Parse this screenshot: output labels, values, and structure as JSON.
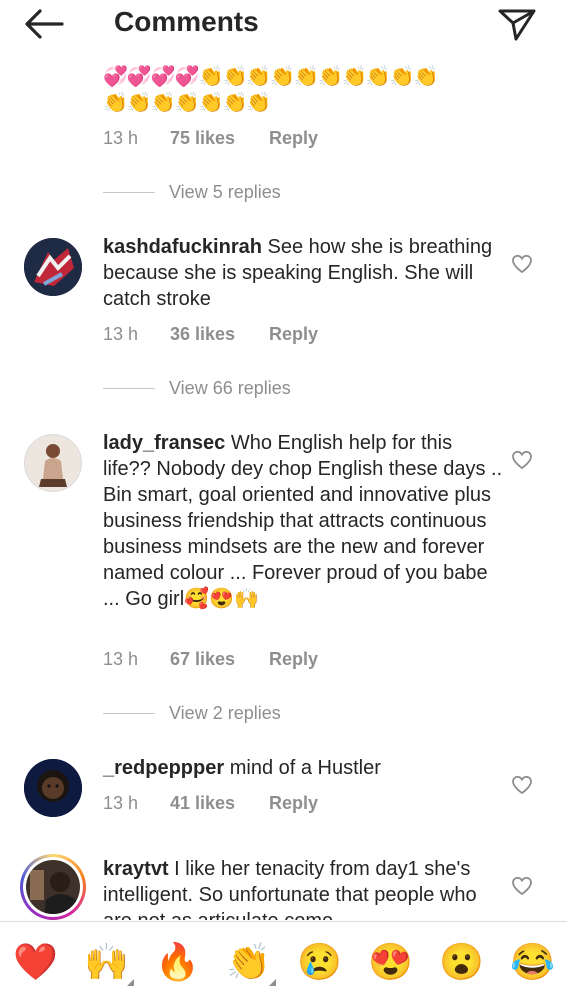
{
  "header": {
    "title": "Comments",
    "back_icon": "arrow-left-icon",
    "send_icon": "paper-plane-icon"
  },
  "top_comment": {
    "emoji_row_1": "💞💞💞💞👏👏👏👏👏👏👏👏👏👏",
    "emoji_row_2": "👏👏👏👏👏👏👏",
    "time": "13 h",
    "likes": "75 likes",
    "reply": "Reply",
    "view_replies": "View 5 replies"
  },
  "comments": [
    {
      "username": "kashdafuckinrah",
      "text": "See how she is breathing because she is speaking English.  She will catch stroke",
      "time": "13 h",
      "likes": "36 likes",
      "reply": "Reply",
      "view_replies": "View 66 replies"
    },
    {
      "username": "lady_fransec",
      "text": "Who English help for this life?? Nobody dey chop English these days .. Bin smart, goal oriented and innovative plus business friendship that attracts continuous business mindsets are the new and forever named colour ... Forever proud of you babe ... Go girl🥰😍🙌",
      "time": "13 h",
      "likes": "67 likes",
      "reply": "Reply",
      "view_replies": "View 2 replies"
    },
    {
      "username": "_redpeppper",
      "text": "mind of a Hustler",
      "time": "13 h",
      "likes": "41 likes",
      "reply": "Reply"
    },
    {
      "username": "kraytvt",
      "text": "I like her tenacity from day1 she's intelligent. So unfortunate that people who are not as articulate come"
    }
  ],
  "reactions": [
    "❤️",
    "🙌",
    "🔥",
    "👏",
    "😢",
    "😍",
    "😮",
    "😂"
  ],
  "colors": {
    "text": "#262626",
    "secondary": "#8e8e8e",
    "divider": "#dbdbdb",
    "story_ring": "#d6249f"
  }
}
